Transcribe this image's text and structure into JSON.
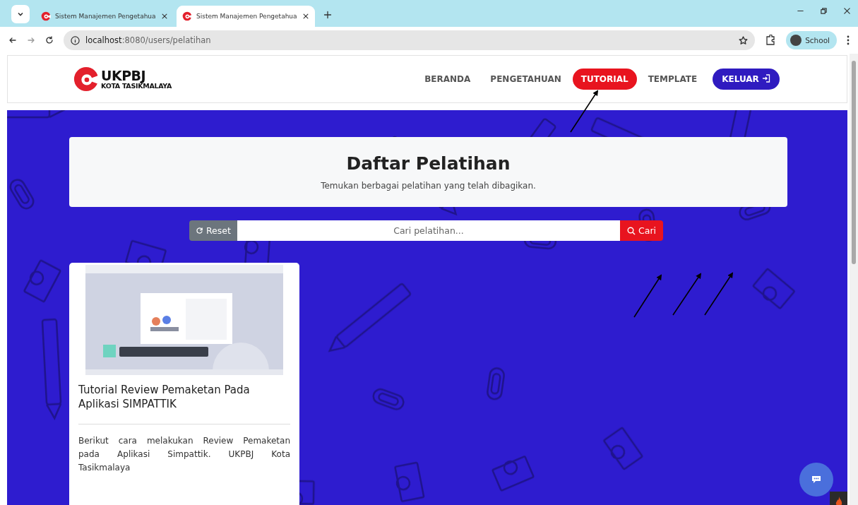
{
  "browser": {
    "tabs": [
      {
        "title": "Sistem Manajemen Pengetahua",
        "selected": false
      },
      {
        "title": "Sistem Manajemen Pengetahua",
        "selected": true
      }
    ],
    "url_host": "localhost",
    "url_path": ":8080/users/pelatihan",
    "profile": "School"
  },
  "nav": {
    "brand": "UKPBJ",
    "brand_sub": "KOTA TASIKMALAYA",
    "items": [
      {
        "label": "BERANDA",
        "selected": false
      },
      {
        "label": "PENGETAHUAN",
        "selected": false
      },
      {
        "label": "TUTORIAL",
        "selected": true
      },
      {
        "label": "TEMPLATE",
        "selected": false
      }
    ],
    "logout": "KELUAR"
  },
  "header": {
    "title": "Daftar Pelatihan",
    "subtitle": "Temukan berbagai pelatihan yang telah dibagikan."
  },
  "search": {
    "reset": "Reset",
    "placeholder": "Cari pelatihan...",
    "submit": "Cari"
  },
  "cards": [
    {
      "title": "Tutorial Review Pemaketan Pada Aplikasi SIMPATTIK",
      "description": "Berikut cara melakukan Review Pemaketan pada Aplikasi Simpattik. UKPBJ Kota Tasikmalaya"
    }
  ]
}
